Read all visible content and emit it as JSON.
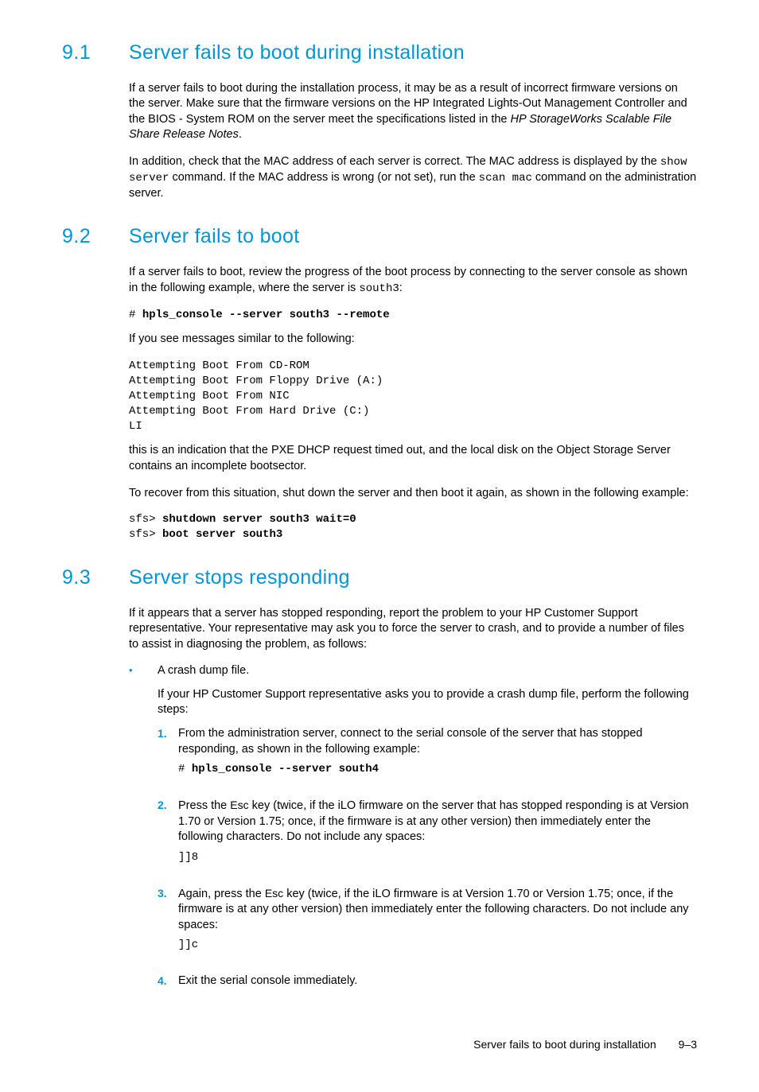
{
  "sections": {
    "s91": {
      "num": "9.1",
      "title": "Server fails to boot during installation",
      "p1a": "If a server fails to boot during the installation process, it may be as a result of incorrect firmware versions on the server. Make sure that the firmware versions on the HP Integrated Lights-Out Management Controller and the BIOS - System ROM on the server meet the specifications listed in the ",
      "p1i": "HP StorageWorks Scalable File Share Release Notes",
      "p1b": ".",
      "p2a": "In addition, check that the MAC address of each server is correct. The MAC address is displayed by the ",
      "p2m1": "show server",
      "p2b": " command. If the MAC address is wrong (or not set), run the ",
      "p2m2": "scan mac",
      "p2c": " command on the administration server."
    },
    "s92": {
      "num": "9.2",
      "title": "Server fails to boot",
      "p1a": "If a server fails to boot, review the progress of the boot process by connecting to the server console as shown in the following example, where the server is ",
      "p1m": "south3",
      "p1b": ":",
      "cmd1_prompt": "# ",
      "cmd1": "hpls_console --server south3 --remote",
      "p2": "If you see messages similar to the following:",
      "pre1": "Attempting Boot From CD-ROM\nAttempting Boot From Floppy Drive (A:)\nAttempting Boot From NIC\nAttempting Boot From Hard Drive (C:)\nLI",
      "p3": "this is an indication that the PXE DHCP request timed out, and the local disk on the Object Storage Server contains an incomplete bootsector.",
      "p4": "To recover from this situation, shut down the server and then boot it again, as shown in the following example:",
      "cmd2a_prompt": "sfs> ",
      "cmd2a": "shutdown server south3 wait=0",
      "cmd2b_prompt": "sfs> ",
      "cmd2b": "boot server south3"
    },
    "s93": {
      "num": "9.3",
      "title": "Server stops responding",
      "p1": "If it appears that a server has stopped responding, report the problem to your HP Customer Support representative. Your representative may ask you to force the server to crash, and to provide a number of files to assist in diagnosing the problem, as follows:",
      "b1_label": "A crash dump file.",
      "b1_sub": "If your HP Customer Support representative asks you to provide a crash dump file, perform the following steps:",
      "n1_num": "1.",
      "n1_text": "From the administration server, connect to the serial console of the server that has stopped responding, as shown in the following example:",
      "n1_cmd_prompt": "# ",
      "n1_cmd": "hpls_console --server south4",
      "n2_num": "2.",
      "n2_a": "Press the ",
      "n2_key": "Esc",
      "n2_b": " key (twice, if the iLO firmware on the server that has stopped responding is at Version 1.70 or Version 1.75; once, if the firmware is at any other version) then immediately enter the following characters. Do not include any spaces:",
      "n2_code": "]]8",
      "n3_num": "3.",
      "n3_a": "Again, press the ",
      "n3_key": "Esc",
      "n3_b": " key (twice, if the iLO firmware is at Version 1.70 or Version 1.75; once, if the firmware is at any other version) then immediately enter the following characters. Do not include any spaces:",
      "n3_code": "]]c",
      "n4_num": "4.",
      "n4_text": "Exit the serial console immediately."
    }
  },
  "footer": {
    "text": "Server fails to boot during installation",
    "page": "9–3"
  }
}
